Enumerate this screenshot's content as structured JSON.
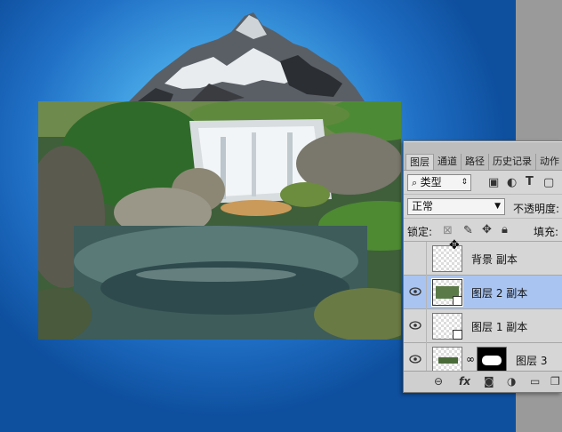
{
  "panel": {
    "tabs": [
      {
        "label": "图层"
      },
      {
        "label": "通道"
      },
      {
        "label": "路径"
      },
      {
        "label": "历史记录"
      },
      {
        "label": "动作"
      }
    ],
    "filter_kind": "类型",
    "blend_mode": "正常",
    "opacity_label": "不透明度:",
    "lock_label": "锁定:",
    "fill_label": "填充:",
    "layers": [
      {
        "name": "背景 副本",
        "visible": false,
        "selected": false
      },
      {
        "name": "图层 2 副本",
        "visible": true,
        "selected": true
      },
      {
        "name": "图层 1 副本",
        "visible": true,
        "selected": false
      },
      {
        "name": "图层 3",
        "visible": true,
        "selected": false
      }
    ],
    "footer_fx": "fx"
  },
  "colors": {
    "selected_layer": "#a9c4f0",
    "canvas_blue": "#1f6fc5"
  }
}
